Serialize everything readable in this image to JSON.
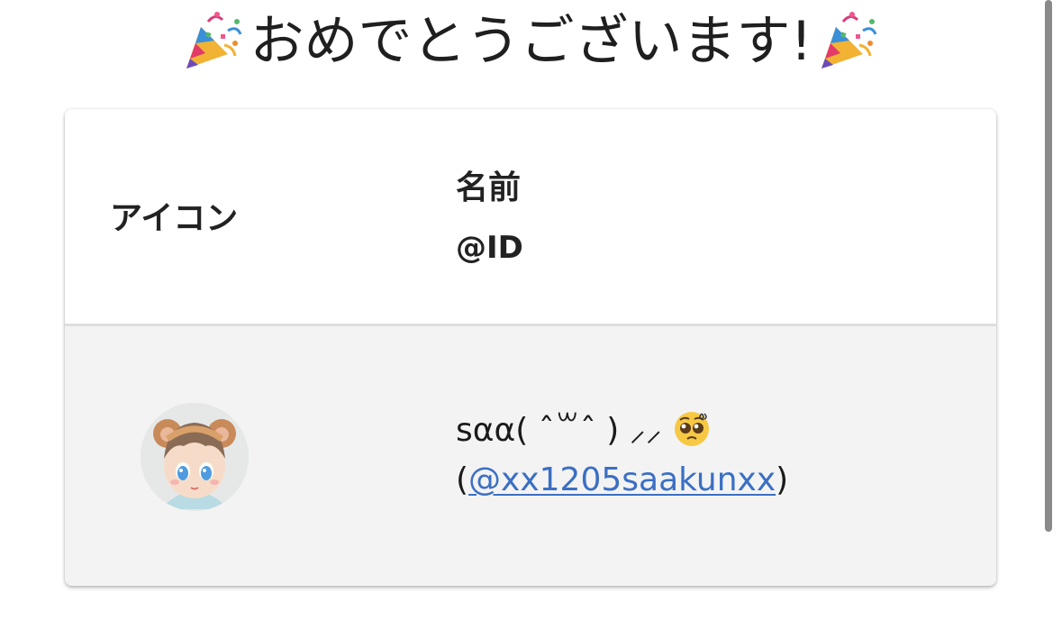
{
  "header": {
    "title": "おめでとうございます!",
    "decoration_icon": "party-popper-icon"
  },
  "table": {
    "columns": {
      "icon_label": "アイコン",
      "name_label": "名前",
      "id_label": "@ID"
    },
    "rows": [
      {
        "avatar_icon": "user-avatar",
        "name": "sαα( ˆ꒳ˆ ) ⸝⸝",
        "name_emoji": "pleading-face-icon",
        "id_open": "(",
        "id": "@xx1205saakunxx",
        "id_close": ")"
      }
    ]
  },
  "colors": {
    "link": "#3b6fc4",
    "row_background": "#f3f3f3",
    "header_background": "#ffffff"
  }
}
